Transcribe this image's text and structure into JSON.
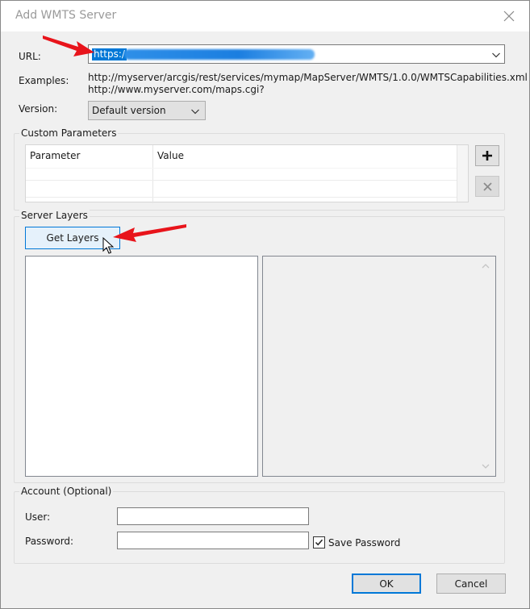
{
  "window": {
    "title": "Add WMTS Server"
  },
  "url": {
    "label": "URL:",
    "value": "https:/"
  },
  "examples": {
    "label": "Examples:",
    "lines": [
      "http://myserver/arcgis/rest/services/mymap/MapServer/WMTS/1.0.0/WMTSCapabilities.xml",
      "http://www.myserver.com/maps.cgi?"
    ]
  },
  "version": {
    "label": "Version:",
    "selected": "Default version"
  },
  "custom_parameters": {
    "title": "Custom Parameters",
    "columns": [
      "Parameter",
      "Value"
    ]
  },
  "server_layers": {
    "title": "Server Layers",
    "get_layers_label": "Get Layers"
  },
  "account": {
    "title": "Account (Optional)",
    "user_label": "User:",
    "password_label": "Password:",
    "save_password_label": "Save Password",
    "save_password_checked": true
  },
  "buttons": {
    "ok": "OK",
    "cancel": "Cancel"
  },
  "icons": {
    "close": "close-icon",
    "add": "plus-icon",
    "remove": "x-icon",
    "dropdown": "chevron-down-icon",
    "cursor": "mouse-pointer-icon",
    "annotation": "red-arrow-icon"
  },
  "colors": {
    "selection": "#0078d7",
    "annotation_arrow": "#e8141b",
    "dialog_bg": "#f0f0f0"
  }
}
